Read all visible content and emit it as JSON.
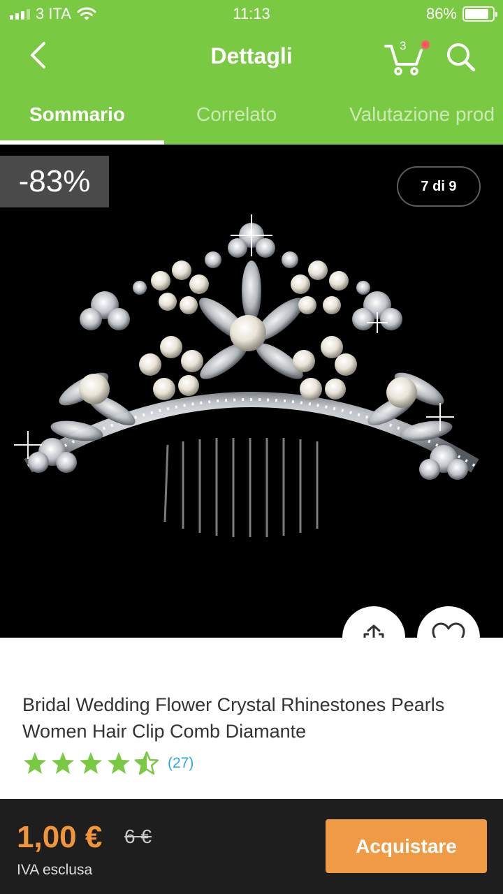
{
  "status_bar": {
    "carrier": "3 ITA",
    "time": "11:13",
    "battery": "86%",
    "battery_level": 0.86
  },
  "nav": {
    "title": "Dettagli",
    "cart_count": "3"
  },
  "tabs": [
    {
      "label": "Sommario",
      "active": true
    },
    {
      "label": "Correlato",
      "active": false
    },
    {
      "label": "Valutazione prod",
      "active": false
    }
  ],
  "gallery": {
    "discount": "-83%",
    "counter": "7 di 9"
  },
  "product": {
    "title": "Bridal Wedding Flower Crystal Rhinestones Pearls Women Hair Clip Comb Diamante",
    "rating": 4.5,
    "review_count": "(27)"
  },
  "purchase": {
    "price": "1,00 €",
    "old_price": "6 €",
    "vat_note": "IVA esclusa",
    "buy_label": "Acquistare"
  },
  "colors": {
    "header_green": "#7ac943",
    "price_orange": "#f0953a",
    "button_orange": "#ef9a45",
    "star_green": "#7ac943",
    "link_blue": "#2aa8e0"
  },
  "icons": {
    "back": "chevron-left-icon",
    "cart": "cart-icon",
    "search": "search-icon",
    "share": "share-icon",
    "favorite": "heart-icon",
    "star": "star-icon"
  }
}
